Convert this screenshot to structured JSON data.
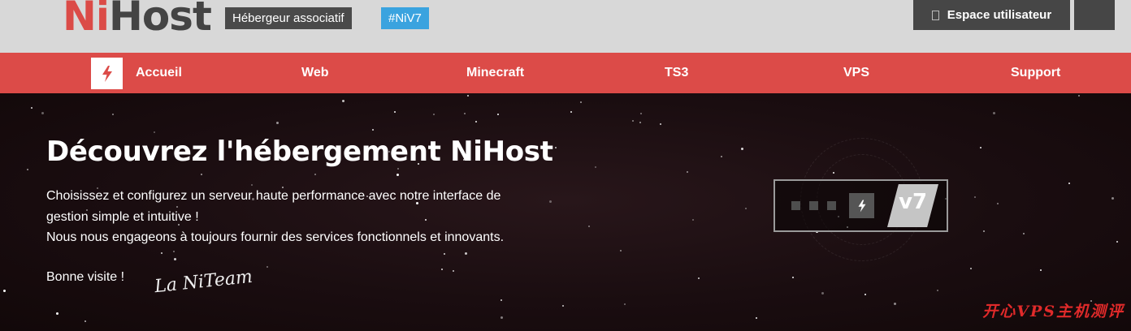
{
  "header": {
    "logo_part1": "Ni",
    "logo_part2": "Host",
    "badge_associatif": "Hébergeur associatif",
    "badge_version": "#NiV7",
    "user_button": "Espace utilisateur",
    "colors": {
      "brand_red": "#dc4b48",
      "badge_blue": "#3aa3df",
      "dark_gray": "#464646"
    }
  },
  "nav": {
    "home_icon": "bolt-icon",
    "items": [
      {
        "label": "Accueil"
      },
      {
        "label": "Web"
      },
      {
        "label": "Minecraft"
      },
      {
        "label": "TS3"
      },
      {
        "label": "VPS"
      },
      {
        "label": "Support"
      }
    ]
  },
  "hero": {
    "title": "Découvrez l'hébergement NiHost",
    "line1": "Choisissez et configurez un serveur haute performance avec notre interface de",
    "line2": "gestion simple et intuitive !",
    "line3": "Nous nous engageons à toujours fournir des services fonctionnels et innovants.",
    "greeting": "Bonne visite !",
    "signature": "La NiTeam",
    "version_label": "v7"
  },
  "watermark": "开心VPS主机测评"
}
